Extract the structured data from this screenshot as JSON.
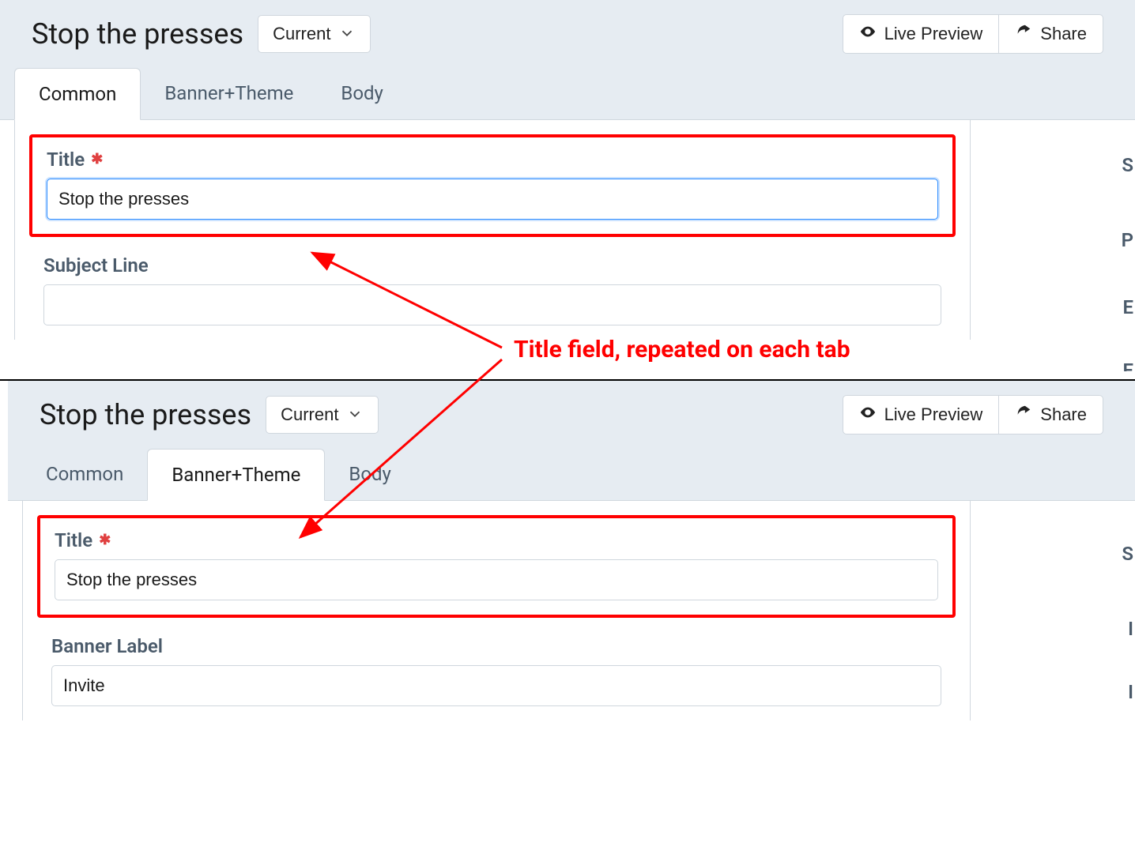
{
  "annotation": {
    "label": "Title field, repeated on each tab"
  },
  "shot1": {
    "header": {
      "title": "Stop the presses",
      "dropdown": "Current",
      "preview": "Live Preview",
      "share": "Share"
    },
    "tabs": {
      "common": "Common",
      "banner": "Banner+Theme",
      "body": "Body"
    },
    "fields": {
      "title_label": "Title",
      "title_value": "Stop the presses",
      "subject_label": "Subject Line",
      "subject_value": ""
    }
  },
  "shot2": {
    "header": {
      "title": "Stop the presses",
      "dropdown": "Current",
      "preview": "Live Preview",
      "share": "Share"
    },
    "tabs": {
      "common": "Common",
      "banner": "Banner+Theme",
      "body": "Body"
    },
    "fields": {
      "title_label": "Title",
      "title_value": "Stop the presses",
      "bannerlabel_label": "Banner Label",
      "bannerlabel_value": "Invite"
    }
  },
  "side": {
    "s": "S",
    "p": "P",
    "e1": "E",
    "e2": "E",
    "s2": "S",
    "i": "I",
    "i2": "I"
  }
}
